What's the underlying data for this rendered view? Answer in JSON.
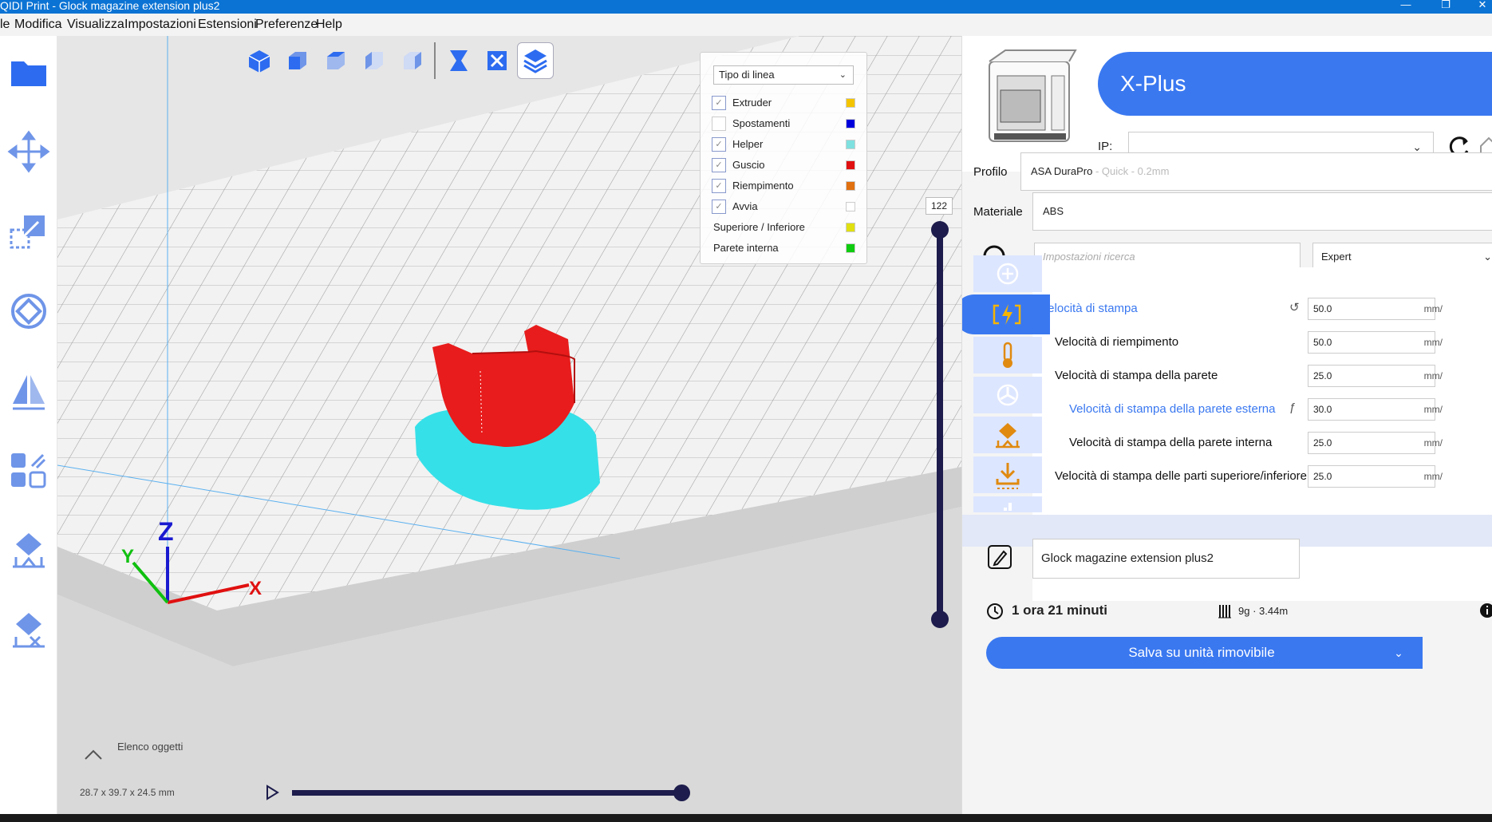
{
  "window": {
    "title": "QIDI Print - Glock magazine extension plus2"
  },
  "menu": [
    "le",
    "Modifica",
    "Visualizza",
    "Impostazioni",
    "Estensioni",
    "Preferenze",
    "Help"
  ],
  "left_toolbar": [
    "folder-icon",
    "move-icon",
    "scale-icon",
    "rotate-icon",
    "mirror-icon",
    "per-model-settings-icon",
    "support-blocker-icon",
    "remove-support-icon"
  ],
  "view_toolbar": [
    "3d-view-icon",
    "front-view-icon",
    "top-view-icon",
    "left-view-icon",
    "right-view-icon",
    "xray-view-icon",
    "close-view-icon",
    "layer-view-icon"
  ],
  "legend": {
    "dropdown": "Tipo di linea",
    "items": [
      {
        "label": "Extruder",
        "checked": true,
        "color": "#f5c400"
      },
      {
        "label": "Spostamenti",
        "checked": false,
        "color": "#0000dd"
      },
      {
        "label": "Helper",
        "checked": true,
        "color": "#7fe0e0"
      },
      {
        "label": "Guscio",
        "checked": true,
        "color": "#e01010"
      },
      {
        "label": "Riempimento",
        "checked": true,
        "color": "#e07010"
      },
      {
        "label": "Avvia",
        "checked": true,
        "color": "#ffffff"
      },
      {
        "label": "Superiore / Inferiore",
        "checked": null,
        "color": "#e0e010"
      },
      {
        "label": "Parete interna",
        "checked": null,
        "color": "#10cc10"
      }
    ]
  },
  "layer": {
    "current": "122"
  },
  "viewport": {
    "object_list_label": "Elenco oggetti",
    "dimensions": "28.7 x 39.7 x 24.5 mm",
    "axis_labels": [
      "Z",
      "Y",
      "X"
    ]
  },
  "printer": {
    "name": "X-Plus",
    "ip_label": "IP:",
    "ip_value": ""
  },
  "profile": {
    "label": "Profilo",
    "value": "ASA DuraPro",
    "quality": " - Quick - 0.2mm"
  },
  "material": {
    "label": "Materiale",
    "value": "ABS"
  },
  "search": {
    "placeholder": "Impostazioni ricerca",
    "mode": "Expert"
  },
  "settings": [
    {
      "label": "Velocità di stampa",
      "value": "50.0",
      "unit": "mm/",
      "level": 0,
      "highlight": true,
      "icon": "reset-icon"
    },
    {
      "label": "Velocità di riempimento",
      "value": "50.0",
      "unit": "mm/",
      "level": 1,
      "highlight": false,
      "icon": ""
    },
    {
      "label": "Velocità di stampa della parete",
      "value": "25.0",
      "unit": "mm/",
      "level": 1,
      "highlight": false,
      "icon": ""
    },
    {
      "label": "Velocità di stampa della parete esterna",
      "value": "30.0",
      "unit": "mm/",
      "level": 2,
      "highlight": true,
      "icon": "function-icon"
    },
    {
      "label": "Velocità di stampa della parete interna",
      "value": "25.0",
      "unit": "mm/",
      "level": 2,
      "highlight": false,
      "icon": ""
    },
    {
      "label": "Velocità di stampa delle parti superiore/inferiore",
      "value": "25.0",
      "unit": "mm/",
      "level": 1,
      "highlight": false,
      "icon": ""
    }
  ],
  "categories": [
    "add-icon",
    "speed-icon",
    "temperature-icon",
    "cooling-icon",
    "support-icon",
    "adhesion-icon",
    "more-icon"
  ],
  "job": {
    "name": "Glock magazine extension plus2",
    "time": "1 ora 21 minuti",
    "material_usage": "9g · 3.44m"
  },
  "save_button": {
    "label": "Salva su unità rimovibile"
  },
  "colors": {
    "accent": "#3a78f0",
    "dark_slider": "#1d1c4c",
    "titlebar": "#0b73d4",
    "model": "#e81c1c",
    "helper": "#36e0e8"
  }
}
